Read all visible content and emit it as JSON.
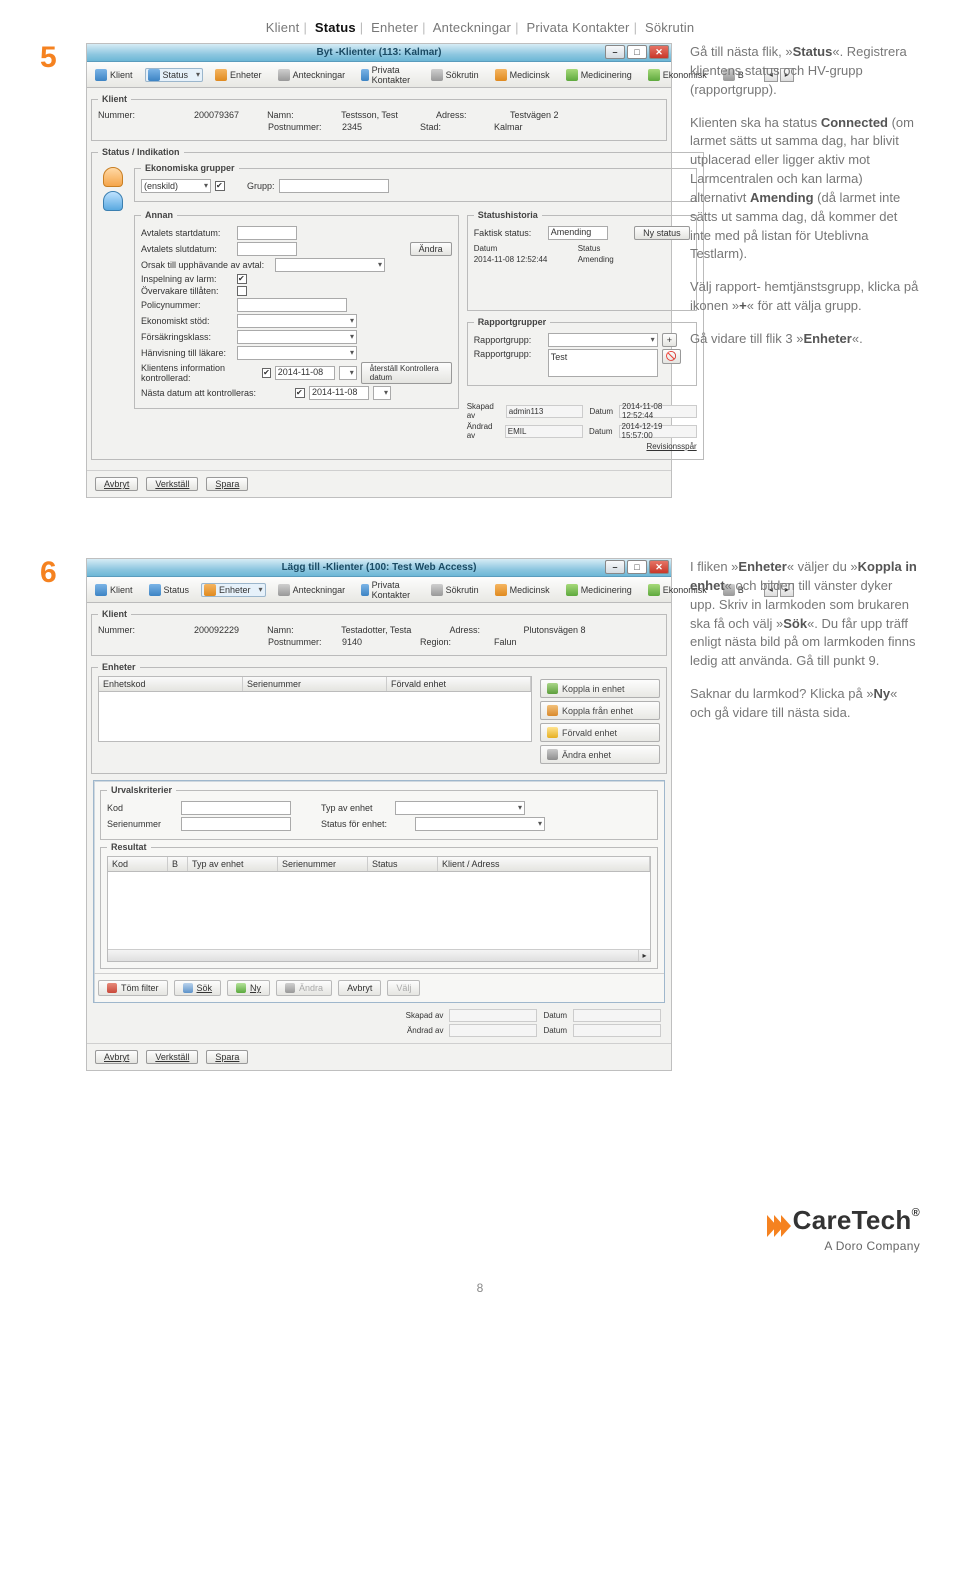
{
  "breadcrumb": {
    "items": [
      "Klient",
      "Status",
      "Enheter",
      "Anteckningar",
      "Privata Kontakter",
      "Sökrutin"
    ],
    "active": 1
  },
  "step5": {
    "num": "5",
    "title": "Byt -Klienter (113: Kalmar)",
    "tabs": [
      "Klient",
      "Status",
      "Enheter",
      "Anteckningar",
      "Privata Kontakter",
      "Sökrutin",
      "Medicinsk",
      "Medicinering",
      "Ekonomisk",
      "B"
    ],
    "sel_tab_index": 1,
    "klient": {
      "legend": "Klient",
      "num_lbl": "Nummer:",
      "num": "200079367",
      "namn_lbl": "Namn:",
      "namn": "Testsson, Test",
      "adr_lbl": "Adress:",
      "adr": "Testvägen 2",
      "pn_lbl": "Postnummer:",
      "pn": "2345",
      "stad_lbl": "Stad:",
      "stad": "Kalmar"
    },
    "status_legend": "Status / Indikation",
    "eko": {
      "legend": "Ekonomiska grupper",
      "val": "(enskild)",
      "chk": true,
      "grp_lbl": "Grupp:",
      "grp": ""
    },
    "annan": {
      "legend": "Annan",
      "start_lbl": "Avtalets startdatum:",
      "slut_lbl": "Avtalets slutdatum:",
      "andra_btn": "Ändra",
      "orsk_lbl": "Orsak till upphävande av avtal:",
      "insp_lbl": "Inspelning av larm:",
      "insp_chk": true,
      "over_lbl": "Övervakare tillåten:",
      "over_chk": false,
      "poli_lbl": "Policynummer:",
      "ekos_lbl": "Ekonomiskt stöd:",
      "fors_lbl": "Försäkringsklass:",
      "hanv_lbl": "Hänvisning till läkare:",
      "info_lbl": "Klientens information kontrollerad:",
      "info_date": "2014-11-08",
      "ater_btn": "återställ Kontrollera datum",
      "nasta_lbl": "Nästa datum att kontrolleras:",
      "nasta_date": "2014-11-08"
    },
    "sh": {
      "legend": "Statushistoria",
      "fs_lbl": "Faktisk status:",
      "fs": "Amending",
      "ny_btn": "Ny status",
      "col_d": "Datum",
      "col_s": "Status",
      "row_d": "2014-11-08 12:52:44",
      "row_s": "Amending"
    },
    "rg": {
      "legend": "Rapportgrupper",
      "rg_lbl": "Rapportgrupp:",
      "rg2_lbl": "Rapportgrupp:",
      "val": "Test",
      "plus": "+",
      "del": "🚫"
    },
    "meta": {
      "skap_lbl": "Skapad av",
      "skap": "admin113",
      "d1_lbl": "Datum",
      "d1": "2014-11-08 12:52:44",
      "and_lbl": "Ändrad av",
      "and": "EMIL",
      "d2": "2014-12-19 15:57:00",
      "rev": "Revisionsspår"
    },
    "footer": {
      "avbryt": "Avbryt",
      "verkstall": "Verkställ",
      "spara": "Spara"
    },
    "copy": {
      "p1a": "Gå till nästa flik, »",
      "p1b": "Status",
      "p1c": "«. Registrera klientens status och HV-grupp (rapportgrupp).",
      "p2a": "Klienten ska ha status ",
      "p2b": "Connected",
      "p2c": " (om larmet sätts ut samma dag, har blivit utplacerad eller ligger aktiv mot Larmcentralen och kan larma) alternativt ",
      "p2d": "Amending",
      "p2e": " (då larmet inte sätts ut samma dag, då kommer det inte med på listan för Uteblivna Testlarm).",
      "p3a": "Välj rapport- hemtjänstsgrupp, klicka på ikonen »",
      "p3b": "+",
      "p3c": "« för att välja grupp.",
      "p4a": "Gå vidare till flik 3 »",
      "p4b": "Enheter",
      "p4c": "«."
    }
  },
  "step6": {
    "num": "6",
    "title": "Lägg till -Klienter (100: Test Web Access)",
    "tabs": [
      "Klient",
      "Status",
      "Enheter",
      "Anteckningar",
      "Privata Kontakter",
      "Sökrutin",
      "Medicinsk",
      "Medicinering",
      "Ekonomisk",
      "B"
    ],
    "sel_tab_index": 2,
    "klient": {
      "legend": "Klient",
      "num_lbl": "Nummer:",
      "num": "200092229",
      "namn_lbl": "Namn:",
      "namn": "Testadotter, Testa",
      "adr_lbl": "Adress:",
      "adr": "Plutonsvägen 8",
      "pn_lbl": "Postnummer:",
      "pn": "9140",
      "reg_lbl": "Region:",
      "reg": "Falun"
    },
    "enh": {
      "legend": "Enheter",
      "c1": "Enhetskod",
      "c2": "Serienummer",
      "c3": "Förvald enhet",
      "a1": "Koppla in enhet",
      "a2": "Koppla från enhet",
      "a3": "Förvald enhet",
      "a4": "Ändra enhet"
    },
    "urv": {
      "legend": "Urvalskriterier",
      "kod_lbl": "Kod",
      "ser_lbl": "Serienummer",
      "typ_lbl": "Typ av enhet",
      "stat_lbl": "Status för enhet:"
    },
    "res": {
      "legend": "Resultat",
      "c1": "Kod",
      "c2": "B",
      "c3": "Typ av enhet",
      "c4": "Serienummer",
      "c5": "Status",
      "c6": "Klient / Adress"
    },
    "tools": {
      "tom": "Töm filter",
      "sok": "Sök",
      "ny": "Ny",
      "andra": "Ändra",
      "avbryt": "Avbryt",
      "valj": "Välj"
    },
    "meta": {
      "skap_lbl": "Skapad av",
      "d_lbl": "Datum",
      "and_lbl": "Ändrad av"
    },
    "footer": {
      "avbryt": "Avbryt",
      "verkstall": "Verkställ",
      "spara": "Spara"
    },
    "copy": {
      "p1a": "I fliken »",
      "p1b": "Enheter",
      "p1c": "« väljer du »",
      "p1d": "Koppla in enhet",
      "p1e": "« och bilden till vänster dyker upp. Skriv in larmkoden som brukaren ska få och välj »",
      "p1f": "Sök",
      "p1g": "«. Du får upp träff enligt nästa bild på om larmkoden finns ledig att använda. Gå till punkt 9.",
      "p2a": "Saknar du larmkod? Klicka på »",
      "p2b": "Ny",
      "p2c": "« och gå vidare till nästa sida."
    }
  },
  "logo": {
    "brand": "CareTech",
    "reg": "®",
    "tag": "A Doro Company"
  },
  "pagenum": "8"
}
